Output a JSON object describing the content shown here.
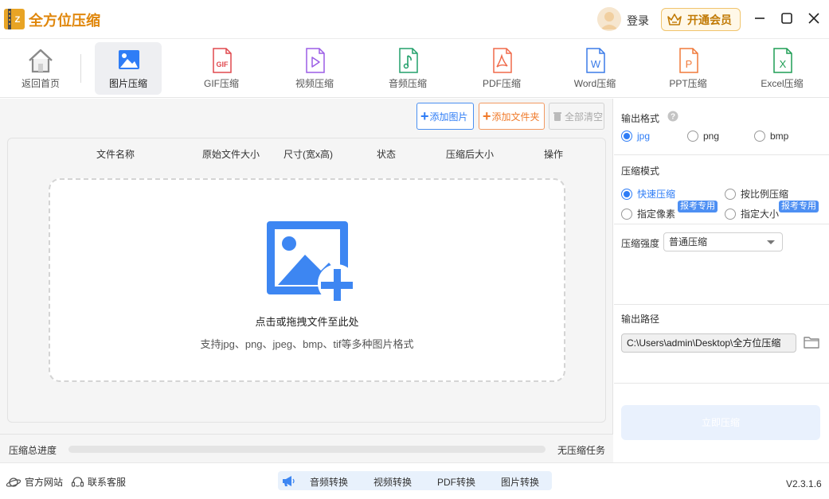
{
  "app": {
    "title": "全方位压缩",
    "login_label": "登录",
    "vip_label": "开通会员"
  },
  "toolbar": {
    "items": [
      {
        "label": "返回首页",
        "icon": "home-icon"
      },
      {
        "label": "图片压缩",
        "icon": "image-icon",
        "active": true
      },
      {
        "label": "GIF压缩",
        "icon": "gif-file-icon"
      },
      {
        "label": "视频压缩",
        "icon": "video-file-icon"
      },
      {
        "label": "音频压缩",
        "icon": "audio-file-icon"
      },
      {
        "label": "PDF压缩",
        "icon": "pdf-file-icon"
      },
      {
        "label": "Word压缩",
        "icon": "word-file-icon"
      },
      {
        "label": "PPT压缩",
        "icon": "ppt-file-icon"
      },
      {
        "label": "Excel压缩",
        "icon": "excel-file-icon"
      }
    ],
    "gif_text": "GIF",
    "word_letter": "W",
    "ppt_letter": "P",
    "excel_letter": "X"
  },
  "actions": {
    "add_image": "添加图片",
    "add_folder": "添加文件夹",
    "clear_all": "全部清空"
  },
  "table": {
    "headers": [
      "文件名称",
      "原始文件大小",
      "尺寸(宽x高)",
      "状态",
      "压缩后大小",
      "操作"
    ]
  },
  "dropzone": {
    "title": "点击或拖拽文件至此处",
    "hint": "支持jpg、png、jpeg、bmp、tif等多种图片格式"
  },
  "progress": {
    "label": "压缩总进度",
    "value": 0,
    "status": "无压缩任务"
  },
  "settings": {
    "output_format": {
      "title": "输出格式",
      "options": [
        "jpg",
        "png",
        "bmp"
      ],
      "selected": "jpg"
    },
    "mode": {
      "title": "压缩模式",
      "options": [
        "快速压缩",
        "按比例压缩",
        "指定像素",
        "指定大小"
      ],
      "selected": "快速压缩",
      "badge": "报考专用"
    },
    "strength": {
      "label": "压缩强度",
      "value": "普通压缩"
    },
    "output_path": {
      "title": "输出路径",
      "value": "C:\\Users\\admin\\Desktop\\全方位压缩"
    },
    "start_label": "立即压缩"
  },
  "footer": {
    "website": "官方网站",
    "support": "联系客服",
    "quick_links": [
      "音频转换",
      "视频转换",
      "PDF转换",
      "图片转换"
    ],
    "version": "V2.3.1.6"
  },
  "colors": {
    "accent": "#2f7df6",
    "brand": "#e0870c",
    "add_folder": "#f07a2a"
  }
}
